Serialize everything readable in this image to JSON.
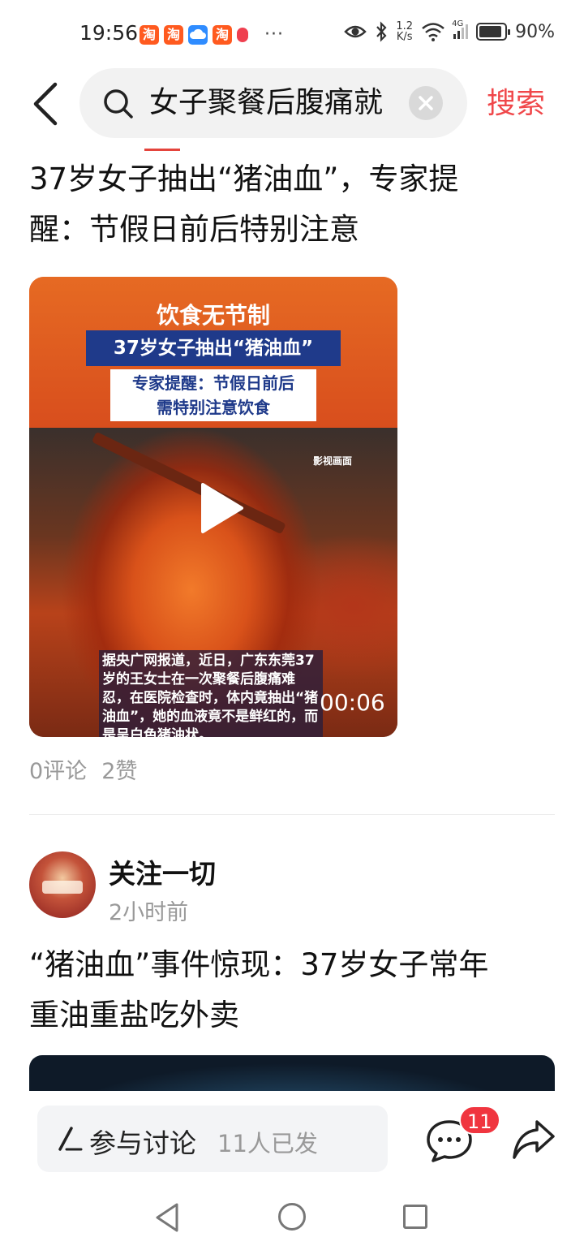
{
  "status_bar": {
    "time": "19:56",
    "app_icons": [
      "淘",
      "淘",
      "cloud-icon",
      "淘",
      "red-app-icon"
    ],
    "more": "···",
    "net_speed_value": "1.2",
    "net_speed_unit": "K/s",
    "signal_label": "4G",
    "battery": "90%",
    "battery_level": 0.9
  },
  "header": {
    "back_icon": "chevron-left-icon",
    "search_query": "女子聚餐后腹痛就",
    "search_button": "搜索"
  },
  "article1": {
    "title_line1": "37岁女子抽出“猪油血”，专家提",
    "title_line2": "醒：节假日前后特别注意",
    "video": {
      "headline": "饮食无节制",
      "banner": "37岁女子抽出“猪油血”",
      "box_line1": "专家提醒：节假日前后",
      "box_line2": "需特别注意饮食",
      "watermark": "影视画面",
      "caption": "据央广网报道，近日，广东东莞37岁的王女士在一次聚餐后腹痛难忍，在医院检查时，体内竟抽出“猪油血”，她的血液竟不是鲜红的，而是呈白色猪油状。",
      "duration": "00:06"
    },
    "comments": "0评论",
    "likes": "2赞"
  },
  "article2": {
    "author": "关注一切",
    "time": "2小时前",
    "title_line1": "“猪油血”事件惊现：37岁女子常年",
    "title_line2": "重油重盐吃外卖"
  },
  "bottom_bar": {
    "discuss_label": "参与讨论",
    "discuss_count": "11人已发",
    "comment_badge": "11"
  },
  "colors": {
    "accent": "#f0474a",
    "badge": "#f0353f",
    "muted": "#999999"
  }
}
